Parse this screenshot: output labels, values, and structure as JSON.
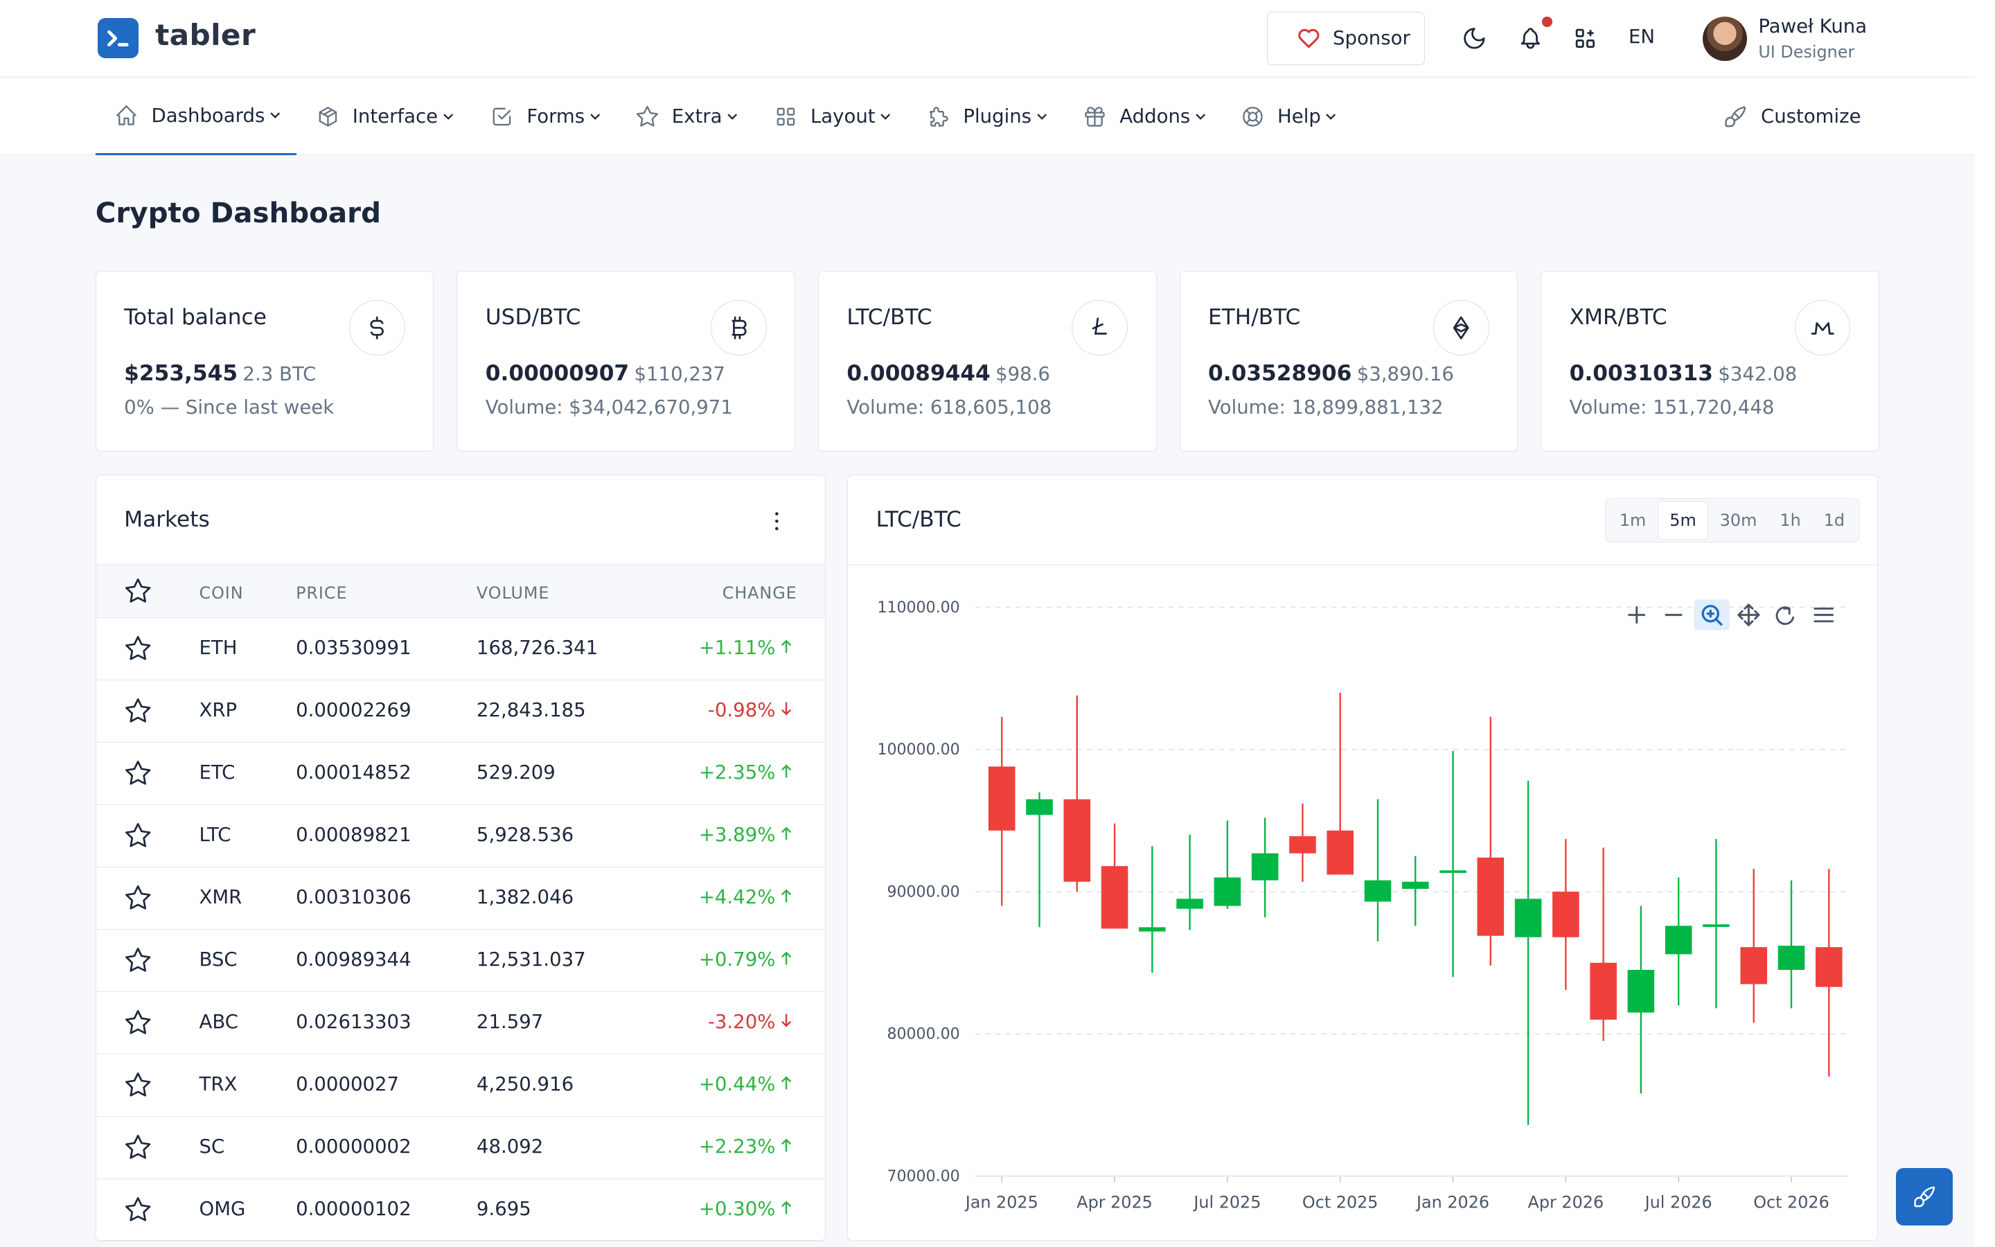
{
  "brand": {
    "name": "tabler"
  },
  "header": {
    "sponsor_label": "Sponsor",
    "language": "EN",
    "user": {
      "name": "Paweł Kuna",
      "role": "UI Designer"
    },
    "icons": [
      "heart-icon",
      "moon-icon",
      "bell-icon",
      "apps-icon"
    ]
  },
  "nav": {
    "items": [
      {
        "label": "Dashboards",
        "icon": "home-icon"
      },
      {
        "label": "Interface",
        "icon": "package-icon"
      },
      {
        "label": "Forms",
        "icon": "checkbox-icon"
      },
      {
        "label": "Extra",
        "icon": "star-icon"
      },
      {
        "label": "Layout",
        "icon": "layout-icon"
      },
      {
        "label": "Plugins",
        "icon": "puzzle-icon"
      },
      {
        "label": "Addons",
        "icon": "gift-icon"
      },
      {
        "label": "Help",
        "icon": "lifebuoy-icon"
      }
    ],
    "customize_label": "Customize"
  },
  "page": {
    "title": "Crypto Dashboard"
  },
  "stats": [
    {
      "title": "Total balance",
      "value": "$253,545",
      "secondary": "2.3 BTC",
      "sub": "0% — Since last week",
      "icon": "dollar-icon"
    },
    {
      "title": "USD/BTC",
      "value": "0.00000907",
      "secondary": "$110,237",
      "sub": "Volume: $34,042,670,971",
      "icon": "bitcoin-icon"
    },
    {
      "title": "LTC/BTC",
      "value": "0.00089444",
      "secondary": "$98.6",
      "sub": "Volume: 618,605,108",
      "icon": "litecoin-icon"
    },
    {
      "title": "ETH/BTC",
      "value": "0.03528906",
      "secondary": "$3,890.16",
      "sub": "Volume: 18,899,881,132",
      "icon": "ethereum-icon"
    },
    {
      "title": "XMR/BTC",
      "value": "0.00310313",
      "secondary": "$342.08",
      "sub": "Volume: 151,720,448",
      "icon": "monero-icon"
    }
  ],
  "markets": {
    "title": "Markets",
    "columns": [
      "COIN",
      "PRICE",
      "VOLUME",
      "CHANGE"
    ],
    "rows": [
      {
        "coin": "ETH",
        "price": "0.03530991",
        "volume": "168,726.341",
        "change": "+1.11%",
        "dir": "up"
      },
      {
        "coin": "XRP",
        "price": "0.00002269",
        "volume": "22,843.185",
        "change": "-0.98%",
        "dir": "down"
      },
      {
        "coin": "ETC",
        "price": "0.00014852",
        "volume": "529.209",
        "change": "+2.35%",
        "dir": "up"
      },
      {
        "coin": "LTC",
        "price": "0.00089821",
        "volume": "5,928.536",
        "change": "+3.89%",
        "dir": "up"
      },
      {
        "coin": "XMR",
        "price": "0.00310306",
        "volume": "1,382.046",
        "change": "+4.42%",
        "dir": "up"
      },
      {
        "coin": "BSC",
        "price": "0.00989344",
        "volume": "12,531.037",
        "change": "+0.79%",
        "dir": "up"
      },
      {
        "coin": "ABC",
        "price": "0.02613303",
        "volume": "21.597",
        "change": "-3.20%",
        "dir": "down"
      },
      {
        "coin": "TRX",
        "price": "0.0000027",
        "volume": "4,250.916",
        "change": "+0.44%",
        "dir": "up"
      },
      {
        "coin": "SC",
        "price": "0.00000002",
        "volume": "48.092",
        "change": "+2.23%",
        "dir": "up"
      },
      {
        "coin": "OMG",
        "price": "0.00000102",
        "volume": "9.695",
        "change": "+0.30%",
        "dir": "up"
      }
    ]
  },
  "chart_panel": {
    "title": "LTC/BTC",
    "timeframes": [
      "1m",
      "5m",
      "30m",
      "1h",
      "1d"
    ],
    "active_timeframe": "5m",
    "toolbar": [
      "zoom-in-icon",
      "zoom-out-icon",
      "selection-zoom-icon",
      "pan-icon",
      "reset-icon",
      "menu-icon"
    ]
  },
  "colors": {
    "accent": "#206bc4",
    "up": "#2fb344",
    "down": "#d63939",
    "candle_up": "#00b746",
    "candle_down": "#ef403c"
  },
  "chart_data": {
    "type": "candlestick",
    "title": "",
    "xlabel": "",
    "ylabel": "",
    "ylim": [
      70000,
      110000
    ],
    "y_ticks": [
      "70000.00",
      "80000.00",
      "90000.00",
      "100000.00",
      "110000.00"
    ],
    "x_ticks": [
      "Jan 2025",
      "Apr 2025",
      "Jul 2025",
      "Oct 2025",
      "Jan 2026",
      "Apr 2026",
      "Jul 2026",
      "Oct 2026"
    ],
    "grid": true,
    "series": [
      {
        "date": "2025-01",
        "open": 98800,
        "high": 102300,
        "low": 89000,
        "close": 94300
      },
      {
        "date": "2025-02",
        "open": 95400,
        "high": 97000,
        "low": 87500,
        "close": 96500
      },
      {
        "date": "2025-03",
        "open": 96500,
        "high": 103800,
        "low": 90000,
        "close": 90700
      },
      {
        "date": "2025-04",
        "open": 91800,
        "high": 94800,
        "low": 88500,
        "close": 87400
      },
      {
        "date": "2025-05",
        "open": 87200,
        "high": 93200,
        "low": 84300,
        "close": 87500
      },
      {
        "date": "2025-06",
        "open": 88800,
        "high": 94000,
        "low": 87300,
        "close": 89500
      },
      {
        "date": "2025-07",
        "open": 89000,
        "high": 95000,
        "low": 88800,
        "close": 91000
      },
      {
        "date": "2025-08",
        "open": 90800,
        "high": 95200,
        "low": 88200,
        "close": 92700
      },
      {
        "date": "2025-09",
        "open": 93900,
        "high": 96200,
        "low": 90700,
        "close": 92700
      },
      {
        "date": "2025-10",
        "open": 94300,
        "high": 104000,
        "low": 91500,
        "close": 91200
      },
      {
        "date": "2025-11",
        "open": 89300,
        "high": 96500,
        "low": 86500,
        "close": 90800
      },
      {
        "date": "2025-12",
        "open": 90200,
        "high": 92500,
        "low": 87600,
        "close": 90700
      },
      {
        "date": "2026-01",
        "open": 91500,
        "high": 99900,
        "low": 84000,
        "close": 91500
      },
      {
        "date": "2026-02",
        "open": 92400,
        "high": 102300,
        "low": 84800,
        "close": 86900
      },
      {
        "date": "2026-03",
        "open": 86800,
        "high": 97800,
        "low": 73600,
        "close": 89500
      },
      {
        "date": "2026-04",
        "open": 90000,
        "high": 93700,
        "low": 83100,
        "close": 86800
      },
      {
        "date": "2026-05",
        "open": 85000,
        "high": 93100,
        "low": 79500,
        "close": 81000
      },
      {
        "date": "2026-06",
        "open": 81500,
        "high": 89000,
        "low": 75800,
        "close": 84500
      },
      {
        "date": "2026-07",
        "open": 85600,
        "high": 91000,
        "low": 82000,
        "close": 87600
      },
      {
        "date": "2026-08",
        "open": 87700,
        "high": 93700,
        "low": 81800,
        "close": 87700
      },
      {
        "date": "2026-09",
        "open": 86100,
        "high": 91600,
        "low": 80800,
        "close": 83500
      },
      {
        "date": "2026-10",
        "open": 84500,
        "high": 90800,
        "low": 81800,
        "close": 86200
      },
      {
        "date": "2026-11",
        "open": 86100,
        "high": 91600,
        "low": 77000,
        "close": 83300
      }
    ]
  }
}
